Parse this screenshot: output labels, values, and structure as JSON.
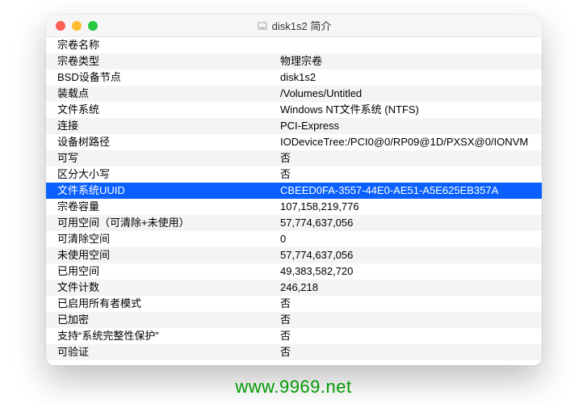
{
  "window": {
    "title": "disk1s2 简介"
  },
  "rows": [
    {
      "label": "宗卷名称",
      "value": ""
    },
    {
      "label": "宗卷类型",
      "value": "物理宗卷"
    },
    {
      "label": "BSD设备节点",
      "value": "disk1s2"
    },
    {
      "label": "装载点",
      "value": "/Volumes/Untitled"
    },
    {
      "label": "文件系统",
      "value": "Windows NT文件系统 (NTFS)"
    },
    {
      "label": "连接",
      "value": "PCI-Express"
    },
    {
      "label": "设备树路径",
      "value": "IODeviceTree:/PCI0@0/RP09@1D/PXSX@0/IONVM"
    },
    {
      "label": "可写",
      "value": "否"
    },
    {
      "label": "区分大小写",
      "value": "否"
    },
    {
      "label": "文件系统UUID",
      "value": "CBEED0FA-3557-44E0-AE51-A5E625EB357A",
      "selected": true
    },
    {
      "label": "宗卷容量",
      "value": "107,158,219,776"
    },
    {
      "label": "可用空间（可清除+未使用）",
      "value": "57,774,637,056"
    },
    {
      "label": "可清除空间",
      "value": "0"
    },
    {
      "label": "未使用空间",
      "value": "57,774,637,056"
    },
    {
      "label": "已用空间",
      "value": "49,383,582,720"
    },
    {
      "label": "文件计数",
      "value": "246,218"
    },
    {
      "label": "已启用所有者模式",
      "value": "否"
    },
    {
      "label": "已加密",
      "value": "否"
    },
    {
      "label": "支持“系统完整性保护”",
      "value": "否"
    },
    {
      "label": "可验证",
      "value": "否"
    }
  ],
  "watermark": "www.9969.net"
}
